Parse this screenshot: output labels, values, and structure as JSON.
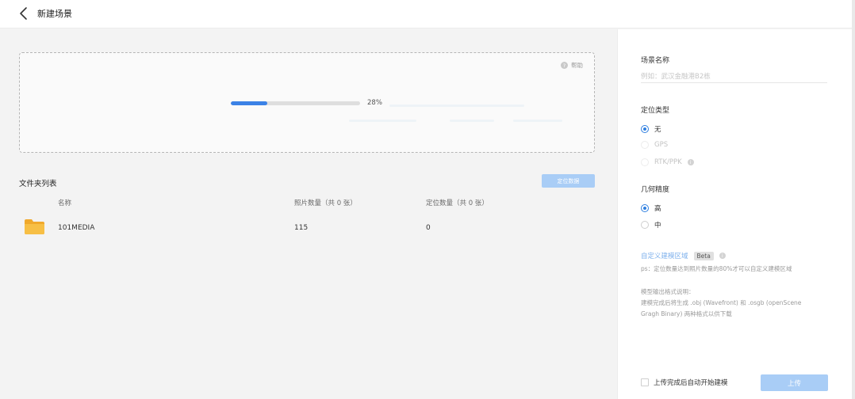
{
  "header": {
    "title": "新建场景"
  },
  "upload_area": {
    "help_label": "帮助",
    "progress_percent": 28,
    "progress_text": "28%"
  },
  "folder_list": {
    "title": "文件夹列表",
    "locate_button": "定位数据",
    "columns": [
      "名称",
      "照片数量（共 0 张）",
      "定位数量（共 0 张）"
    ],
    "rows": [
      {
        "name": "101MEDIA",
        "photos": "115",
        "locations": "0"
      }
    ]
  },
  "settings": {
    "scene_name": {
      "label": "场景名称",
      "placeholder": "例如：武汉金融港B2栋",
      "value": ""
    },
    "position_type": {
      "label": "定位类型",
      "options": [
        {
          "label": "无",
          "checked": true,
          "disabled": false
        },
        {
          "label": "GPS",
          "checked": false,
          "disabled": true
        },
        {
          "label": "RTK/PPK",
          "checked": false,
          "disabled": true
        }
      ]
    },
    "precision": {
      "label": "几何精度",
      "options": [
        {
          "label": "高",
          "checked": true
        },
        {
          "label": "中",
          "checked": false
        }
      ]
    },
    "custom_area": {
      "link": "自定义建模区域",
      "badge": "Beta",
      "hint": "ps：定位数量达到照片数量的80%才可以自定义建模区域"
    },
    "output_note": {
      "title": "模型输出格式说明：",
      "line1": "建模完成后将生成 .obj (Wavefront) 和 .osgb (openScene",
      "line2": "Gragh Binary) 两种格式以供下载"
    },
    "auto_build_label": "上传完成后自动开始建模",
    "upload_button": "上传"
  },
  "colors": {
    "accent": "#2f7fe0",
    "button_disabled": "#a9cdf6",
    "folder": "#f5b83d"
  },
  "icons": [
    "back-arrow-icon",
    "help-icon",
    "folder-icon",
    "info-icon"
  ]
}
